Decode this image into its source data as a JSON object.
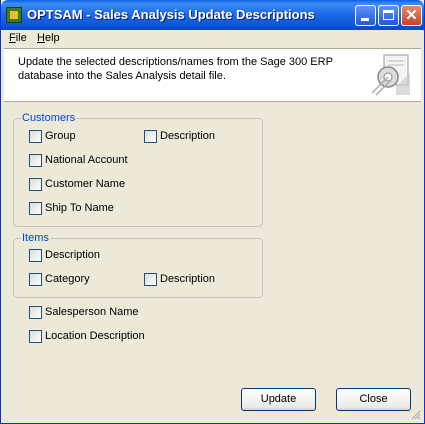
{
  "window": {
    "title": "OPTSAM - Sales Analysis Update Descriptions"
  },
  "menu": {
    "file": "File",
    "help": "Help"
  },
  "header": {
    "description": "Update the selected descriptions/names from the Sage 300 ERP database into the Sales Analysis detail file."
  },
  "customers": {
    "legend": "Customers",
    "group": "Group",
    "group_description": "Description",
    "national_account": "National Account",
    "customer_name": "Customer Name",
    "ship_to_name": "Ship To Name"
  },
  "items": {
    "legend": "Items",
    "description": "Description",
    "category": "Category",
    "category_description": "Description"
  },
  "other": {
    "salesperson_name": "Salesperson Name",
    "location_description": "Location Description"
  },
  "buttons": {
    "update": "Update",
    "close": "Close"
  },
  "icons": {
    "app": "app-icon",
    "logo": "document-gear-icon",
    "minimize": "minimize-icon",
    "maximize": "maximize-icon",
    "close": "close-icon"
  },
  "colors": {
    "title_bar": "#0A5FE0",
    "group_label": "#0046D5",
    "face": "#ECE9D8"
  }
}
